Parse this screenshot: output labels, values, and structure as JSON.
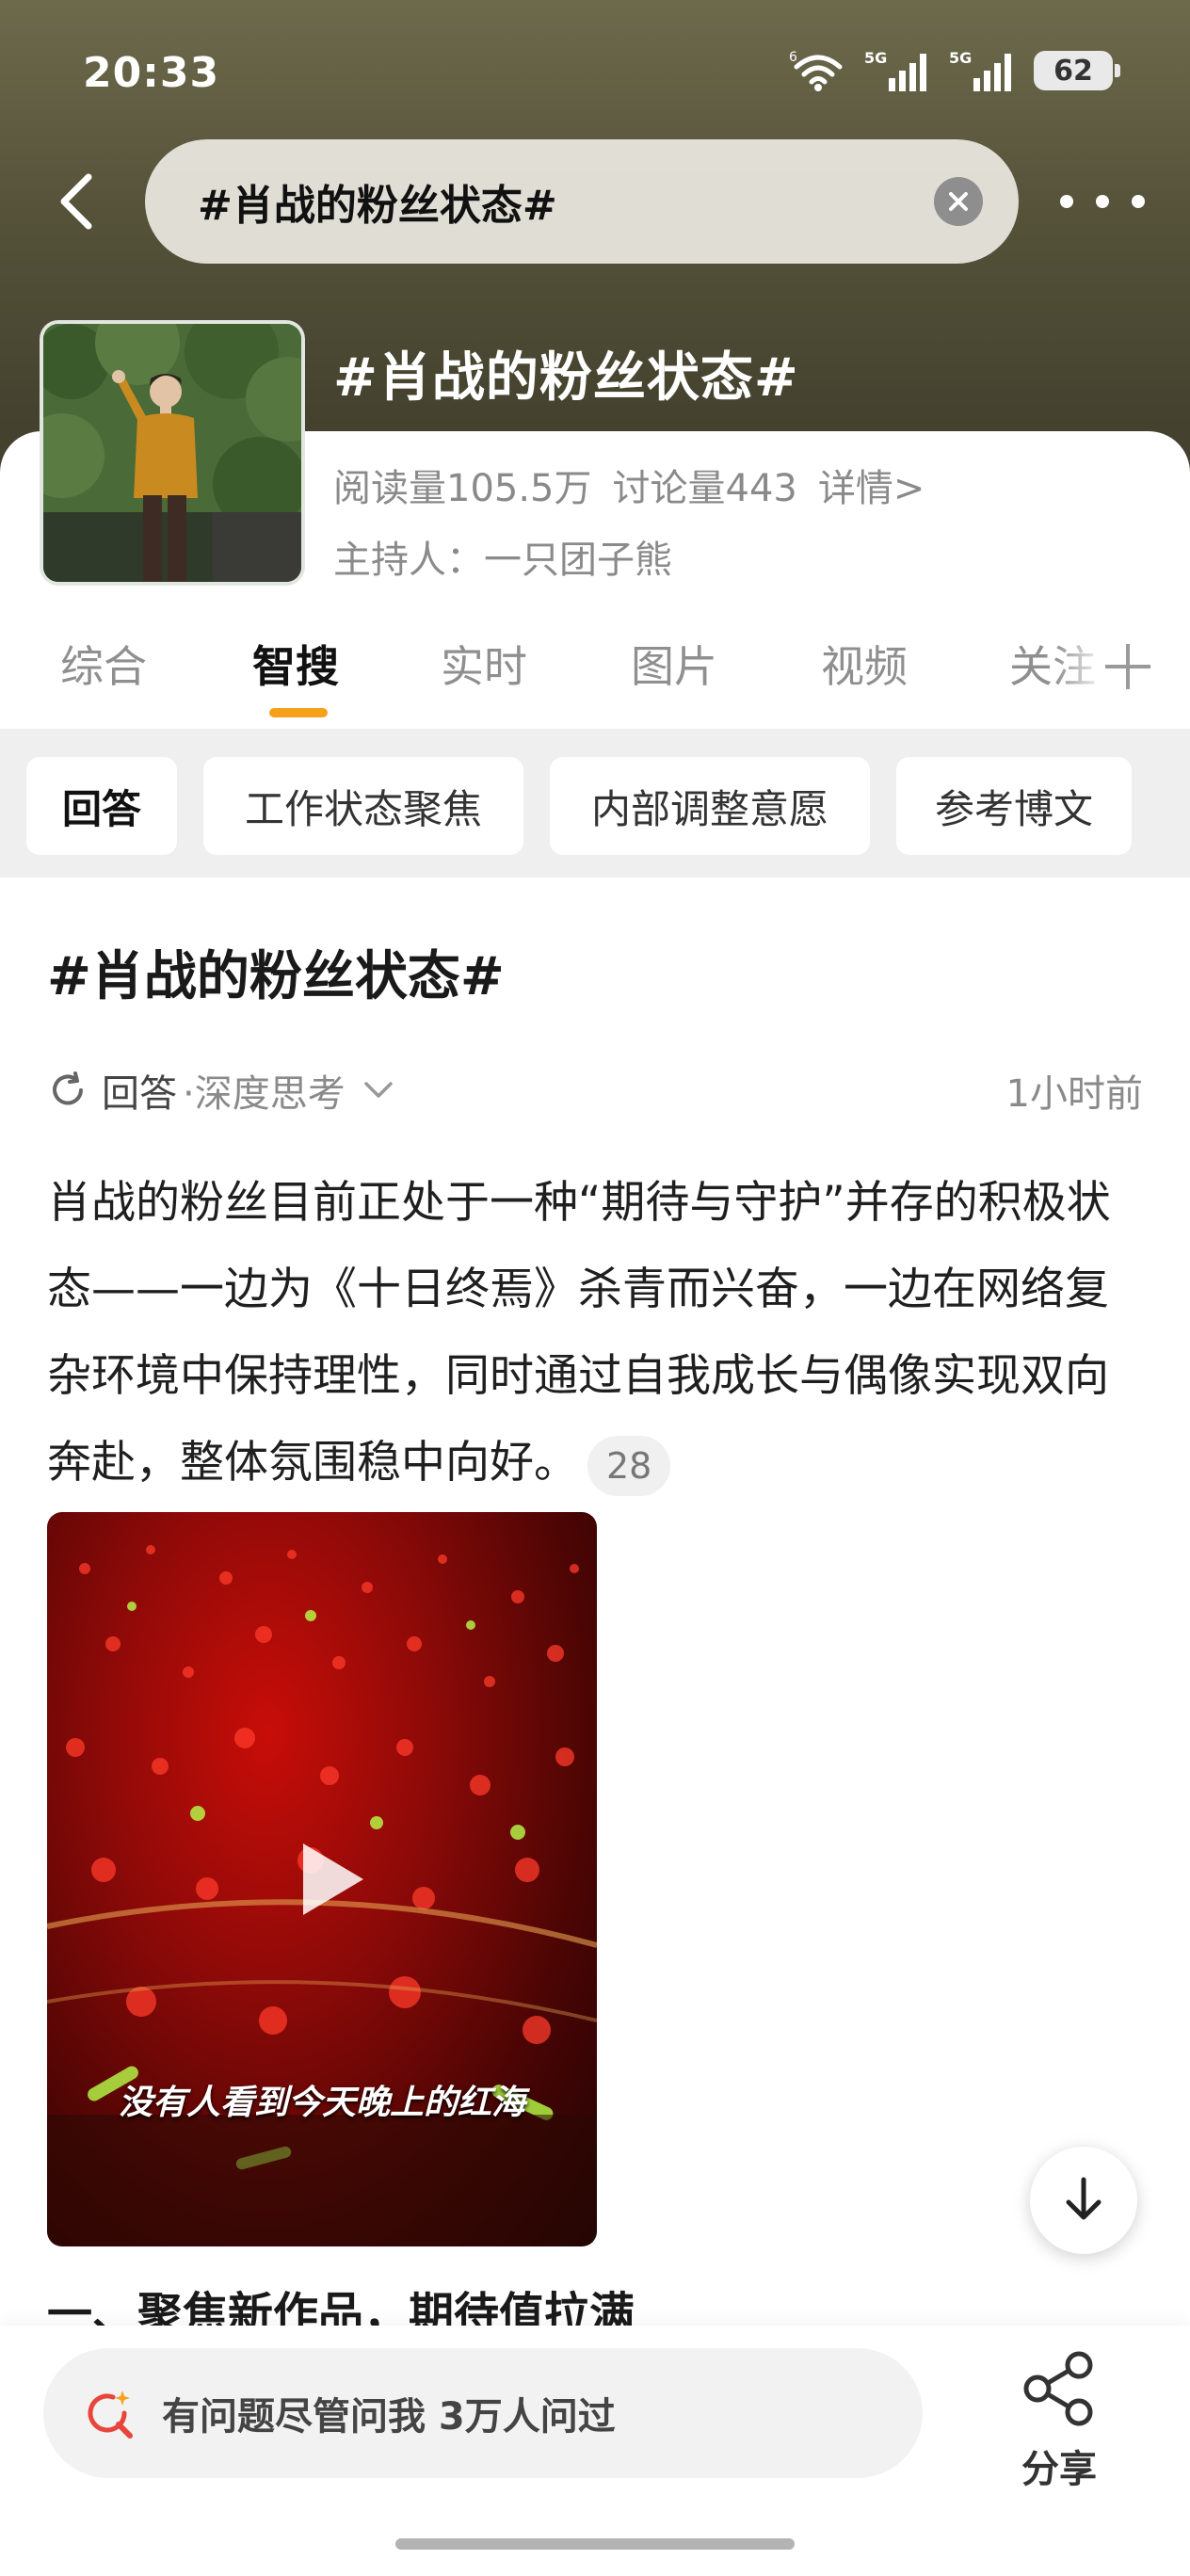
{
  "status_bar": {
    "time": "20:33",
    "wifi_badge": "6",
    "signal_1": "5G",
    "signal_2": "5G",
    "battery": "62"
  },
  "search": {
    "query": "#肖战的粉丝状态#"
  },
  "topic": {
    "title": "#肖战的粉丝状态#",
    "reads": "阅读量105.5万",
    "discussions": "讨论量443",
    "detail_link": "详情>",
    "host_label": "主持人：",
    "host_name": "一只团子熊"
  },
  "tabs": [
    {
      "label": "综合",
      "active": false
    },
    {
      "label": "智搜",
      "active": true
    },
    {
      "label": "实时",
      "active": false
    },
    {
      "label": "图片",
      "active": false
    },
    {
      "label": "视频",
      "active": false
    },
    {
      "label": "关注",
      "active": false
    }
  ],
  "chips": [
    {
      "label": "回答",
      "active": true
    },
    {
      "label": "工作状态聚焦",
      "active": false
    },
    {
      "label": "内部调整意愿",
      "active": false
    },
    {
      "label": "参考博文",
      "active": false
    }
  ],
  "content": {
    "title": "#肖战的粉丝状态#",
    "meta_label": "回答",
    "meta_sub": "·深度思考",
    "time": "1小时前",
    "answer": "肖战的粉丝目前正处于一种“期待与守护”并存的积极状态——一边为《十日终焉》杀青而兴奋，一边在网络复杂环境中保持理性，同时通过自我成长与偶像实现双向奔赴，整体氛围稳中向好。",
    "citation": "28",
    "video_caption": "没有人看到今天晚上的红海",
    "section_heading": "一、聚焦新作品，期待值拉满"
  },
  "bottom": {
    "ask_placeholder": "有问题尽管问我 3万人问过",
    "share_label": "分享"
  },
  "colors": {
    "header_bg": "#56533a",
    "tab_indicator": "#f5a11c",
    "ai_icon_red": "#e8453c"
  }
}
